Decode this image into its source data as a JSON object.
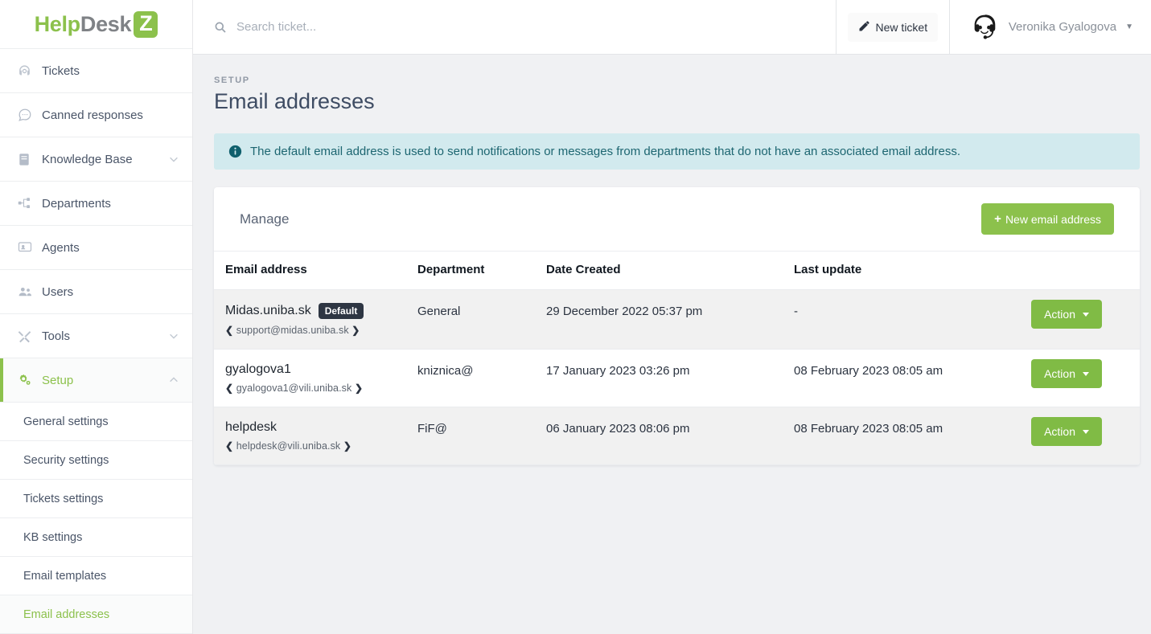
{
  "brand": {
    "part1": "Help",
    "part2": "Desk",
    "part3": "Z"
  },
  "sidebar": {
    "items": [
      {
        "label": "Tickets",
        "icon": "headset-icon",
        "expandable": false
      },
      {
        "label": "Canned responses",
        "icon": "chat-bubble-icon",
        "expandable": false
      },
      {
        "label": "Knowledge Base",
        "icon": "book-icon",
        "expandable": true
      },
      {
        "label": "Departments",
        "icon": "sitemap-icon",
        "expandable": false
      },
      {
        "label": "Agents",
        "icon": "agent-icon",
        "expandable": false
      },
      {
        "label": "Users",
        "icon": "users-icon",
        "expandable": false
      },
      {
        "label": "Tools",
        "icon": "wrench-icon",
        "expandable": true
      },
      {
        "label": "Setup",
        "icon": "gears-icon",
        "expandable": true,
        "active": true
      }
    ],
    "setup_subitems": [
      {
        "label": "General settings"
      },
      {
        "label": "Security settings"
      },
      {
        "label": "Tickets settings"
      },
      {
        "label": "KB settings"
      },
      {
        "label": "Email templates"
      },
      {
        "label": "Email addresses",
        "current": true
      }
    ]
  },
  "topbar": {
    "search_placeholder": "Search ticket...",
    "search_value": "",
    "new_ticket_label": "New ticket",
    "user_name": "Veronika Gyalogova"
  },
  "page": {
    "eyebrow": "SETUP",
    "title": "Email addresses",
    "alert_text": "The default email address is used to send notifications or messages from departments that do not have an associated email address."
  },
  "card": {
    "title": "Manage",
    "new_email_label": "New email address",
    "plus": "+"
  },
  "table": {
    "headers": [
      "Email address",
      "Department",
      "Date Created",
      "Last update"
    ],
    "action_label": "Action",
    "rows": [
      {
        "name": "Midas.uniba.sk",
        "badge": "Default",
        "email": "support@midas.uniba.sk",
        "department": "General",
        "created": "29 December 2022 05:37 pm",
        "updated": "-"
      },
      {
        "name": "gyalogova1",
        "badge": "",
        "email": "gyalogova1@vili.uniba.sk",
        "department": "kniznica@",
        "created": "17 January 2023 03:26 pm",
        "updated": "08 February 2023 08:05 am"
      },
      {
        "name": "helpdesk",
        "badge": "",
        "email": "helpdesk@vili.uniba.sk",
        "department": "FiF@",
        "created": "06 January 2023 08:06 pm",
        "updated": "08 February 2023 08:05 am"
      }
    ]
  },
  "colors": {
    "brand_green": "#8cc14c",
    "action_green": "#80bb45",
    "alert_bg": "#d2eaee",
    "alert_text": "#1d6671",
    "badge_bg": "#2e3643"
  }
}
